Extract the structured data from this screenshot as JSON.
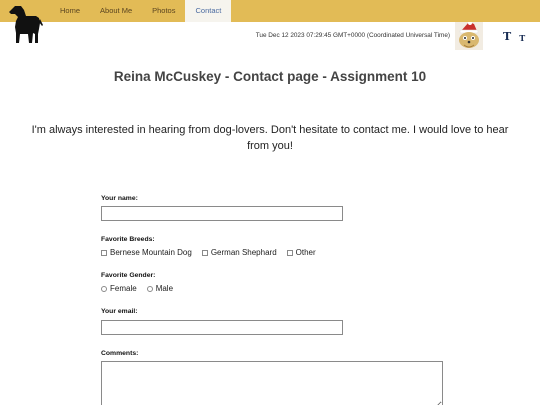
{
  "nav": {
    "items": [
      {
        "label": "Home"
      },
      {
        "label": "About Me"
      },
      {
        "label": "Photos"
      },
      {
        "label": "Contact"
      }
    ],
    "active": "Contact"
  },
  "header": {
    "datetime": "Tue Dec 12 2023 07:29:45 GMT+0000 (Coordinated Universal Time)",
    "font_large_label": "T",
    "font_small_label": "T"
  },
  "page": {
    "title": "Reina McCuskey - Contact page - Assignment 10",
    "intro": "I'm always interested in hearing from dog-lovers. Don't hesitate to contact me. I would love to hear from you!"
  },
  "form": {
    "name_label": "Your name:",
    "name_value": "",
    "breeds_label": "Favorite Breeds:",
    "breeds": [
      "Bernese Mountain Dog",
      "German Shephard",
      "Other"
    ],
    "gender_label": "Favorite Gender:",
    "genders": [
      "Female",
      "Male"
    ],
    "email_label": "Your email:",
    "email_value": "",
    "comments_label": "Comments:",
    "comments_value": ""
  },
  "colors": {
    "topbar": "#e2bb56",
    "active_tab_bg": "#f6f4ee",
    "font_icon": "#1a2e55"
  },
  "icons": [
    "dog-logo-icon",
    "avatar-icon",
    "font-size-large-icon",
    "font-size-small-icon"
  ]
}
